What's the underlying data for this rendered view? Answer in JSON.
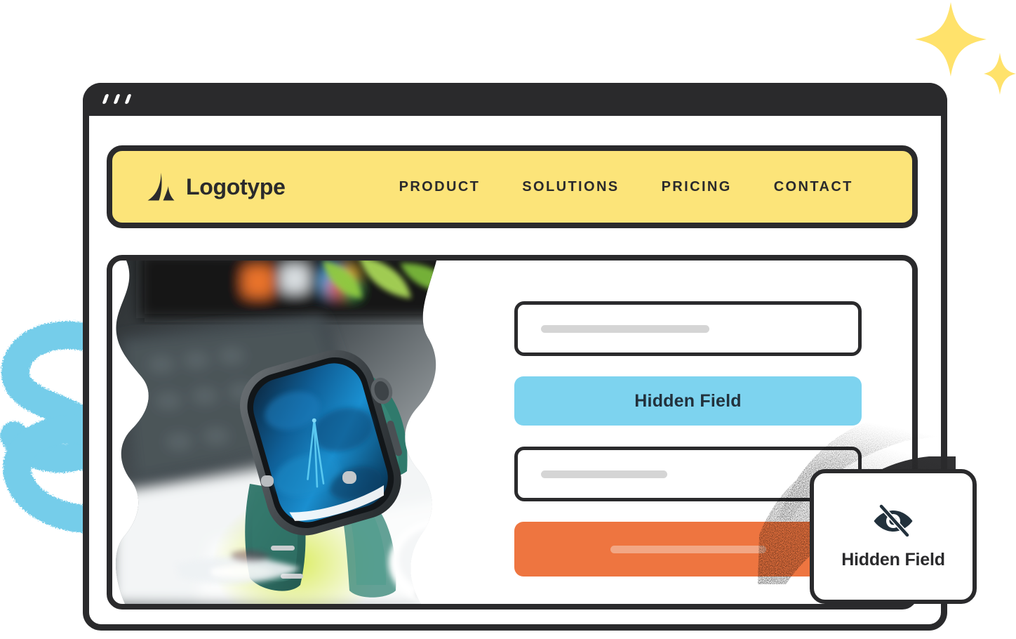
{
  "window": {
    "dots_count": 3,
    "chrome_color": "#2a2a2c"
  },
  "navbar": {
    "background_color": "#fce479",
    "logo_icon": "logotype-mark-icon",
    "brand_name": "Logotype",
    "links": [
      {
        "label": "PRODUCT"
      },
      {
        "label": "SOLUTIONS"
      },
      {
        "label": "PRICING"
      },
      {
        "label": "CONTACT"
      }
    ]
  },
  "panel": {
    "image": {
      "icon": "smartwatch-photo",
      "description": "Smartwatch with teal leather band resting on a laptop keyboard beside green plant leaves"
    },
    "form": {
      "field_one": {
        "placeholder": "",
        "value": ""
      },
      "hidden_field": {
        "label": "Hidden Field",
        "background_color": "#7dd3ef"
      },
      "field_two": {
        "placeholder": "",
        "value": ""
      },
      "submit": {
        "label": "",
        "background_color": "#ee7540"
      }
    }
  },
  "callout": {
    "icon": "eye-off-icon",
    "label": "Hidden Field"
  },
  "decor": {
    "sparkle_color": "#ffe26b",
    "swoosh_color": "#74cdea"
  }
}
